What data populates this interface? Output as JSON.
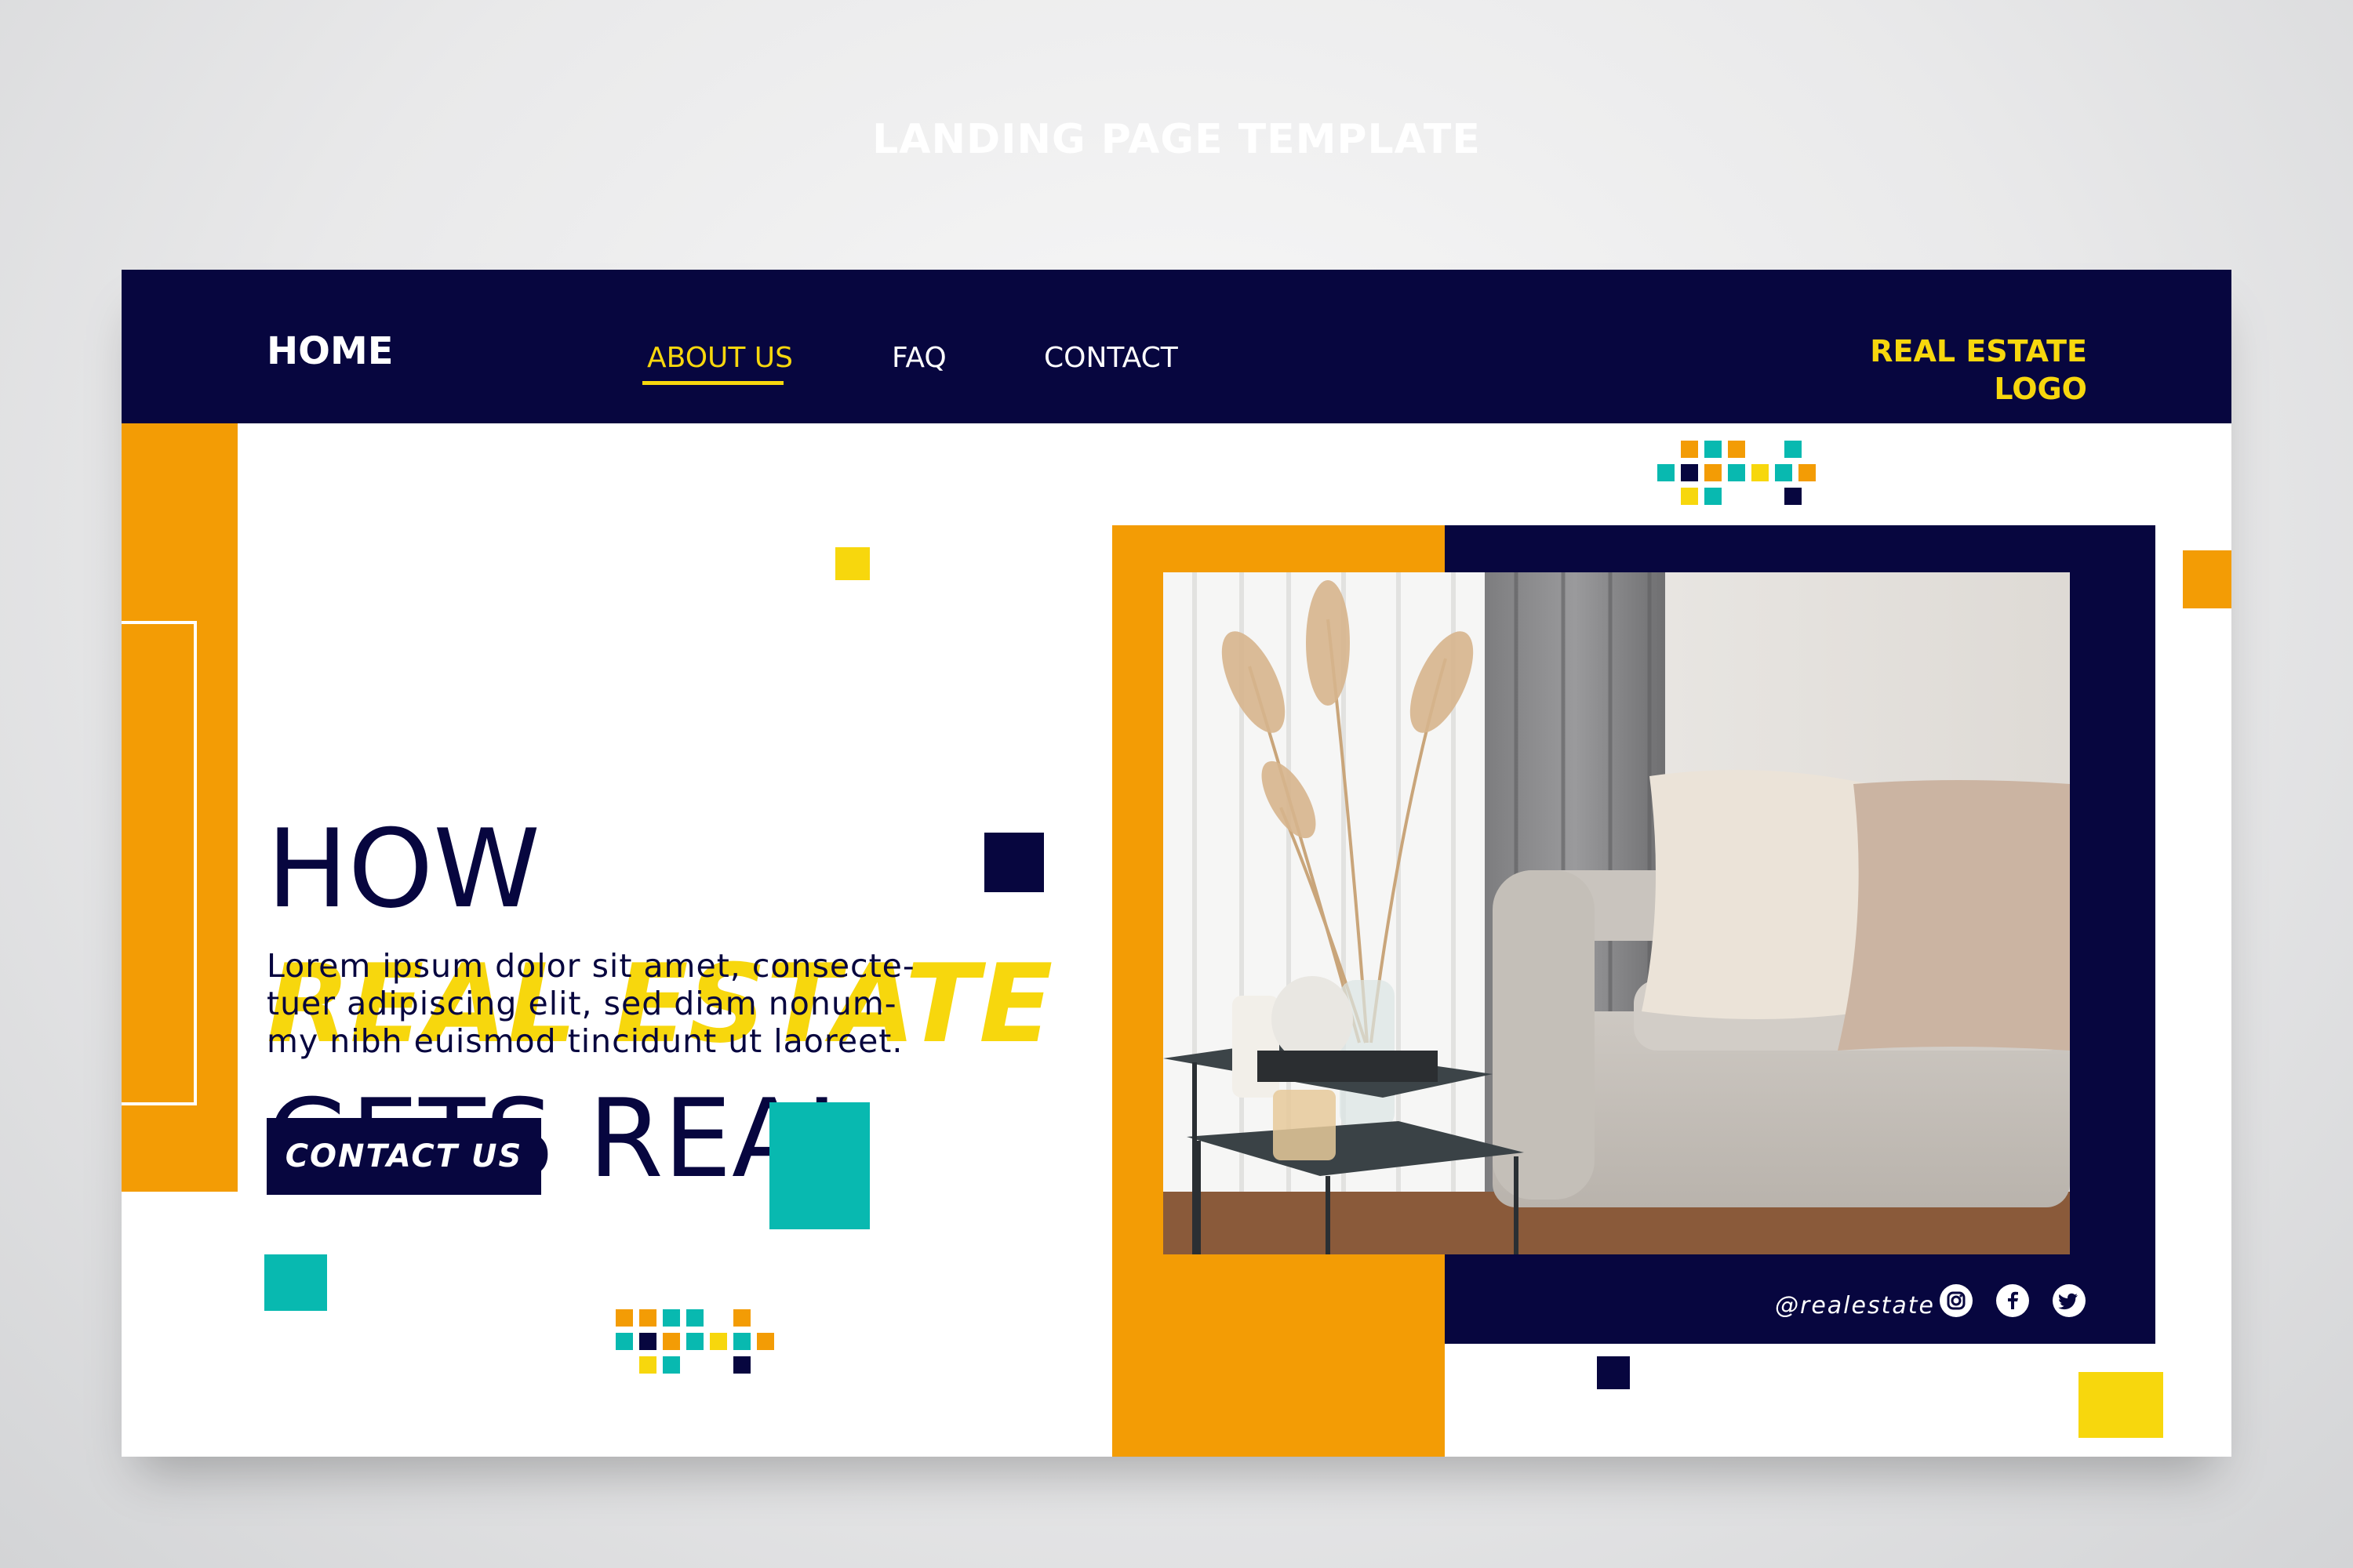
{
  "page_caption": "LANDING PAGE TEMPLATE",
  "nav": {
    "home": "HOME",
    "links": [
      "ABOUT US",
      "FAQ",
      "CONTACT"
    ],
    "active_link": "ABOUT US",
    "logo_line1": "REAL ESTATE",
    "logo_line2": "LOGO"
  },
  "hero": {
    "line1": "HOW",
    "line2": "REAL ESTATE",
    "line3": "GETS REAL",
    "desc_line1": "Lorem ipsum dolor sit amet, consecte-",
    "desc_line2": "tuer adipiscing elit, sed diam nonum-",
    "desc_line3": "my nibh euismod tincidunt ut laoreet.",
    "cta": "CONTACT US"
  },
  "social": {
    "handle": "@realestate",
    "icons": [
      "instagram-icon",
      "facebook-icon",
      "twitter-icon"
    ]
  },
  "colors": {
    "navy": "#07063f",
    "orange": "#f39c05",
    "yellow": "#f7d70d",
    "teal": "#08b9b0"
  }
}
